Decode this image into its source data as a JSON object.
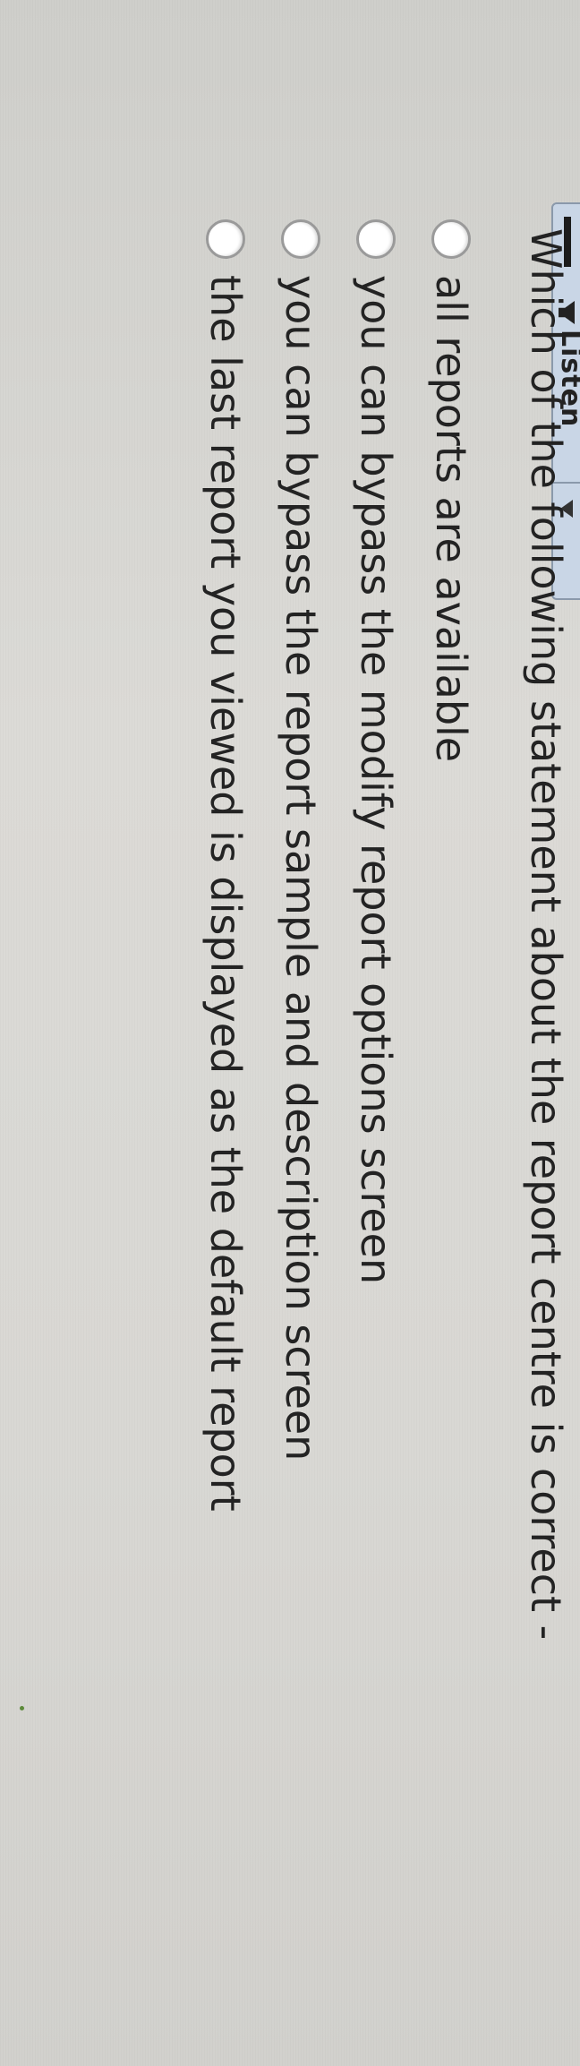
{
  "listen_widget": {
    "label": "Listen",
    "icon": "speaker-icon",
    "accent": "#c9d6e6"
  },
  "question": {
    "text": "Which of the following statement about the report centre is correct -",
    "options": [
      {
        "label": "all reports are available"
      },
      {
        "label": "you can bypass the modify report options screen"
      },
      {
        "label": "you can bypass the report sample and description screen"
      },
      {
        "label": "the last report you viewed is displayed as the default report"
      }
    ]
  }
}
